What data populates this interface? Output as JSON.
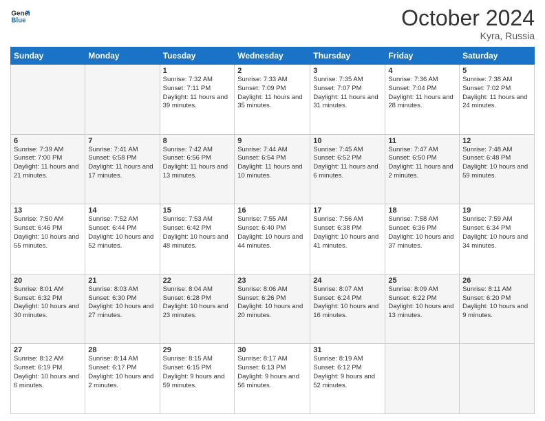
{
  "logo": {
    "line1": "General",
    "line2": "Blue"
  },
  "title": "October 2024",
  "subtitle": "Kyra, Russia",
  "days_header": [
    "Sunday",
    "Monday",
    "Tuesday",
    "Wednesday",
    "Thursday",
    "Friday",
    "Saturday"
  ],
  "weeks": [
    [
      {
        "day": "",
        "info": ""
      },
      {
        "day": "",
        "info": ""
      },
      {
        "day": "1",
        "info": "Sunrise: 7:32 AM\nSunset: 7:11 PM\nDaylight: 11 hours and 39 minutes."
      },
      {
        "day": "2",
        "info": "Sunrise: 7:33 AM\nSunset: 7:09 PM\nDaylight: 11 hours and 35 minutes."
      },
      {
        "day": "3",
        "info": "Sunrise: 7:35 AM\nSunset: 7:07 PM\nDaylight: 11 hours and 31 minutes."
      },
      {
        "day": "4",
        "info": "Sunrise: 7:36 AM\nSunset: 7:04 PM\nDaylight: 11 hours and 28 minutes."
      },
      {
        "day": "5",
        "info": "Sunrise: 7:38 AM\nSunset: 7:02 PM\nDaylight: 11 hours and 24 minutes."
      }
    ],
    [
      {
        "day": "6",
        "info": "Sunrise: 7:39 AM\nSunset: 7:00 PM\nDaylight: 11 hours and 21 minutes."
      },
      {
        "day": "7",
        "info": "Sunrise: 7:41 AM\nSunset: 6:58 PM\nDaylight: 11 hours and 17 minutes."
      },
      {
        "day": "8",
        "info": "Sunrise: 7:42 AM\nSunset: 6:56 PM\nDaylight: 11 hours and 13 minutes."
      },
      {
        "day": "9",
        "info": "Sunrise: 7:44 AM\nSunset: 6:54 PM\nDaylight: 11 hours and 10 minutes."
      },
      {
        "day": "10",
        "info": "Sunrise: 7:45 AM\nSunset: 6:52 PM\nDaylight: 11 hours and 6 minutes."
      },
      {
        "day": "11",
        "info": "Sunrise: 7:47 AM\nSunset: 6:50 PM\nDaylight: 11 hours and 2 minutes."
      },
      {
        "day": "12",
        "info": "Sunrise: 7:48 AM\nSunset: 6:48 PM\nDaylight: 10 hours and 59 minutes."
      }
    ],
    [
      {
        "day": "13",
        "info": "Sunrise: 7:50 AM\nSunset: 6:46 PM\nDaylight: 10 hours and 55 minutes."
      },
      {
        "day": "14",
        "info": "Sunrise: 7:52 AM\nSunset: 6:44 PM\nDaylight: 10 hours and 52 minutes."
      },
      {
        "day": "15",
        "info": "Sunrise: 7:53 AM\nSunset: 6:42 PM\nDaylight: 10 hours and 48 minutes."
      },
      {
        "day": "16",
        "info": "Sunrise: 7:55 AM\nSunset: 6:40 PM\nDaylight: 10 hours and 44 minutes."
      },
      {
        "day": "17",
        "info": "Sunrise: 7:56 AM\nSunset: 6:38 PM\nDaylight: 10 hours and 41 minutes."
      },
      {
        "day": "18",
        "info": "Sunrise: 7:58 AM\nSunset: 6:36 PM\nDaylight: 10 hours and 37 minutes."
      },
      {
        "day": "19",
        "info": "Sunrise: 7:59 AM\nSunset: 6:34 PM\nDaylight: 10 hours and 34 minutes."
      }
    ],
    [
      {
        "day": "20",
        "info": "Sunrise: 8:01 AM\nSunset: 6:32 PM\nDaylight: 10 hours and 30 minutes."
      },
      {
        "day": "21",
        "info": "Sunrise: 8:03 AM\nSunset: 6:30 PM\nDaylight: 10 hours and 27 minutes."
      },
      {
        "day": "22",
        "info": "Sunrise: 8:04 AM\nSunset: 6:28 PM\nDaylight: 10 hours and 23 minutes."
      },
      {
        "day": "23",
        "info": "Sunrise: 8:06 AM\nSunset: 6:26 PM\nDaylight: 10 hours and 20 minutes."
      },
      {
        "day": "24",
        "info": "Sunrise: 8:07 AM\nSunset: 6:24 PM\nDaylight: 10 hours and 16 minutes."
      },
      {
        "day": "25",
        "info": "Sunrise: 8:09 AM\nSunset: 6:22 PM\nDaylight: 10 hours and 13 minutes."
      },
      {
        "day": "26",
        "info": "Sunrise: 8:11 AM\nSunset: 6:20 PM\nDaylight: 10 hours and 9 minutes."
      }
    ],
    [
      {
        "day": "27",
        "info": "Sunrise: 8:12 AM\nSunset: 6:19 PM\nDaylight: 10 hours and 6 minutes."
      },
      {
        "day": "28",
        "info": "Sunrise: 8:14 AM\nSunset: 6:17 PM\nDaylight: 10 hours and 2 minutes."
      },
      {
        "day": "29",
        "info": "Sunrise: 8:15 AM\nSunset: 6:15 PM\nDaylight: 9 hours and 59 minutes."
      },
      {
        "day": "30",
        "info": "Sunrise: 8:17 AM\nSunset: 6:13 PM\nDaylight: 9 hours and 56 minutes."
      },
      {
        "day": "31",
        "info": "Sunrise: 8:19 AM\nSunset: 6:12 PM\nDaylight: 9 hours and 52 minutes."
      },
      {
        "day": "",
        "info": ""
      },
      {
        "day": "",
        "info": ""
      }
    ]
  ]
}
